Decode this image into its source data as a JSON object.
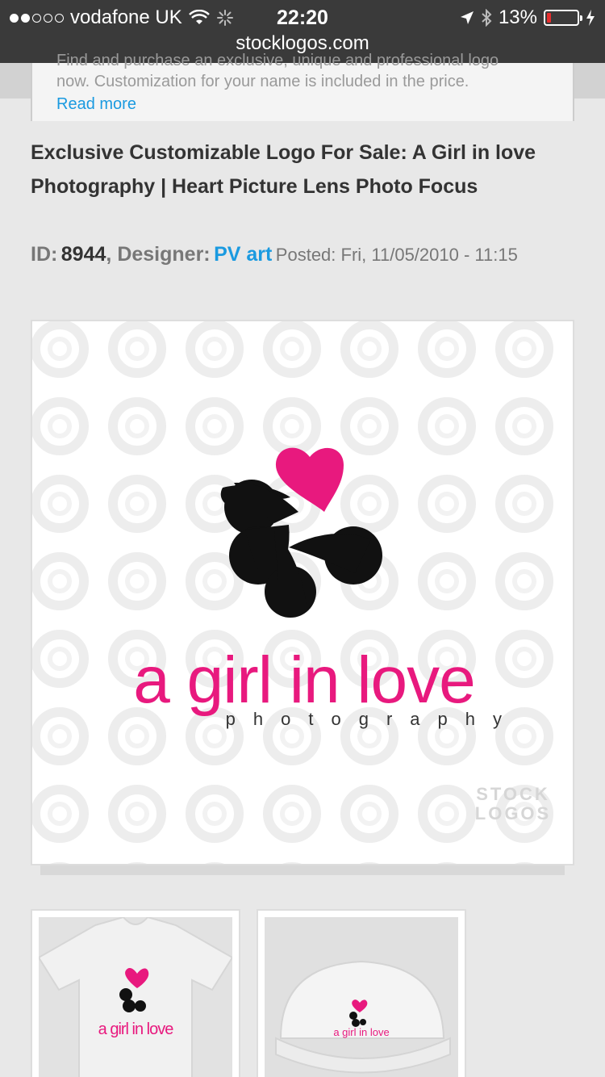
{
  "status_bar": {
    "carrier": "vodafone UK",
    "time": "22:20",
    "battery": "13%",
    "battery_level": 0.13,
    "url": "stocklogos.com"
  },
  "description": {
    "clipped_line": "Find and purchase an exclusive, unique and professional logo",
    "line2": "now. Customization for your name is included in the price.",
    "read_more": "Read more"
  },
  "product": {
    "title": "Exclusive Customizable Logo For Sale: A Girl in love Photography | Heart Picture Lens Photo Focus",
    "id_label": "ID:",
    "id_value": "8944",
    "designer_label": "Designer:",
    "designer_name": "PV art",
    "posted": "Posted: Fri, 11/05/2010 - 11:15"
  },
  "logo": {
    "wordmark": "a girl in love",
    "tagline": "photography",
    "watermark_line1": "STOCK",
    "watermark_line2": "LOGOS",
    "colors": {
      "pink": "#e8197e",
      "black": "#111111"
    }
  },
  "thumbnails": [
    {
      "kind": "t-shirt-mockup",
      "wordmark": "a girl in love"
    },
    {
      "kind": "cap-mockup",
      "wordmark": "a girl in love"
    }
  ]
}
